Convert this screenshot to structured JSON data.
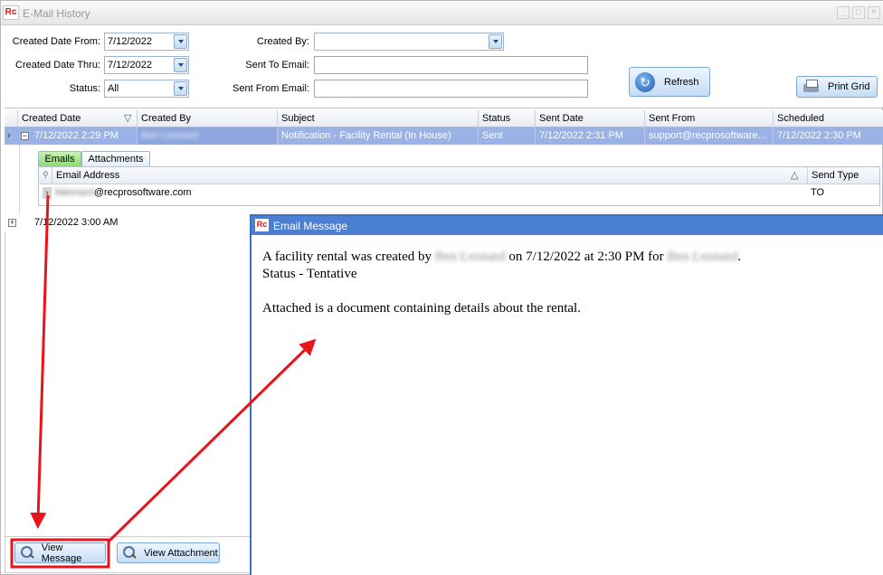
{
  "window": {
    "title": "E-Mail History",
    "logo_text": "Rc"
  },
  "filters": {
    "created_from_label": "Created Date From:",
    "created_from_value": "7/12/2022",
    "created_thru_label": "Created Date Thru:",
    "created_thru_value": "7/12/2022",
    "status_label": "Status:",
    "status_value": "All",
    "created_by_label": "Created By:",
    "created_by_value": "",
    "sent_to_label": "Sent To Email:",
    "sent_to_value": "",
    "sent_from_label": "Sent From Email:",
    "sent_from_value": ""
  },
  "toolbar": {
    "refresh_label": "Refresh",
    "print_label": "Print Grid"
  },
  "grid": {
    "columns": [
      "Created Date",
      "Created By",
      "Subject",
      "Status",
      "Sent Date",
      "Sent From",
      "Scheduled"
    ],
    "rows": [
      {
        "created_date": "7/12/2022 2:29 PM",
        "created_by": "Ben Leonard",
        "subject": "Notification - Facility Rental (In House)",
        "status": "Sent",
        "sent_date": "7/12/2022 2:31 PM",
        "sent_from": "support@recprosoftware...",
        "scheduled": "7/12/2022 2:30 PM"
      },
      {
        "created_date": "7/12/2022 3:00 AM"
      }
    ]
  },
  "detail": {
    "tabs": [
      "Emails",
      "Attachments"
    ],
    "columns": [
      "Email Address",
      "Send Type"
    ],
    "row": {
      "email_user": "bleonard",
      "email_domain": "@recprosoftware.com",
      "send_type": "TO"
    }
  },
  "actions": {
    "view_message_label": "View Message",
    "view_attachment_label": "View Attachment"
  },
  "email_message": {
    "title": "Email Message",
    "line1_prefix": "A facility rental was created by ",
    "line1_name1": "Ben Leonard",
    "line1_middle": " on 7/12/2022 at 2:30 PM for ",
    "line1_name2": "Ben Leonard",
    "line1_suffix": ".",
    "line2": "Status - Tentative",
    "line3": "Attached is a document containing details about the rental."
  },
  "colors": {
    "selected_row": "#9ab2e6",
    "annotation_red": "#e8141b",
    "email_title_blue": "#4a7fd1"
  }
}
